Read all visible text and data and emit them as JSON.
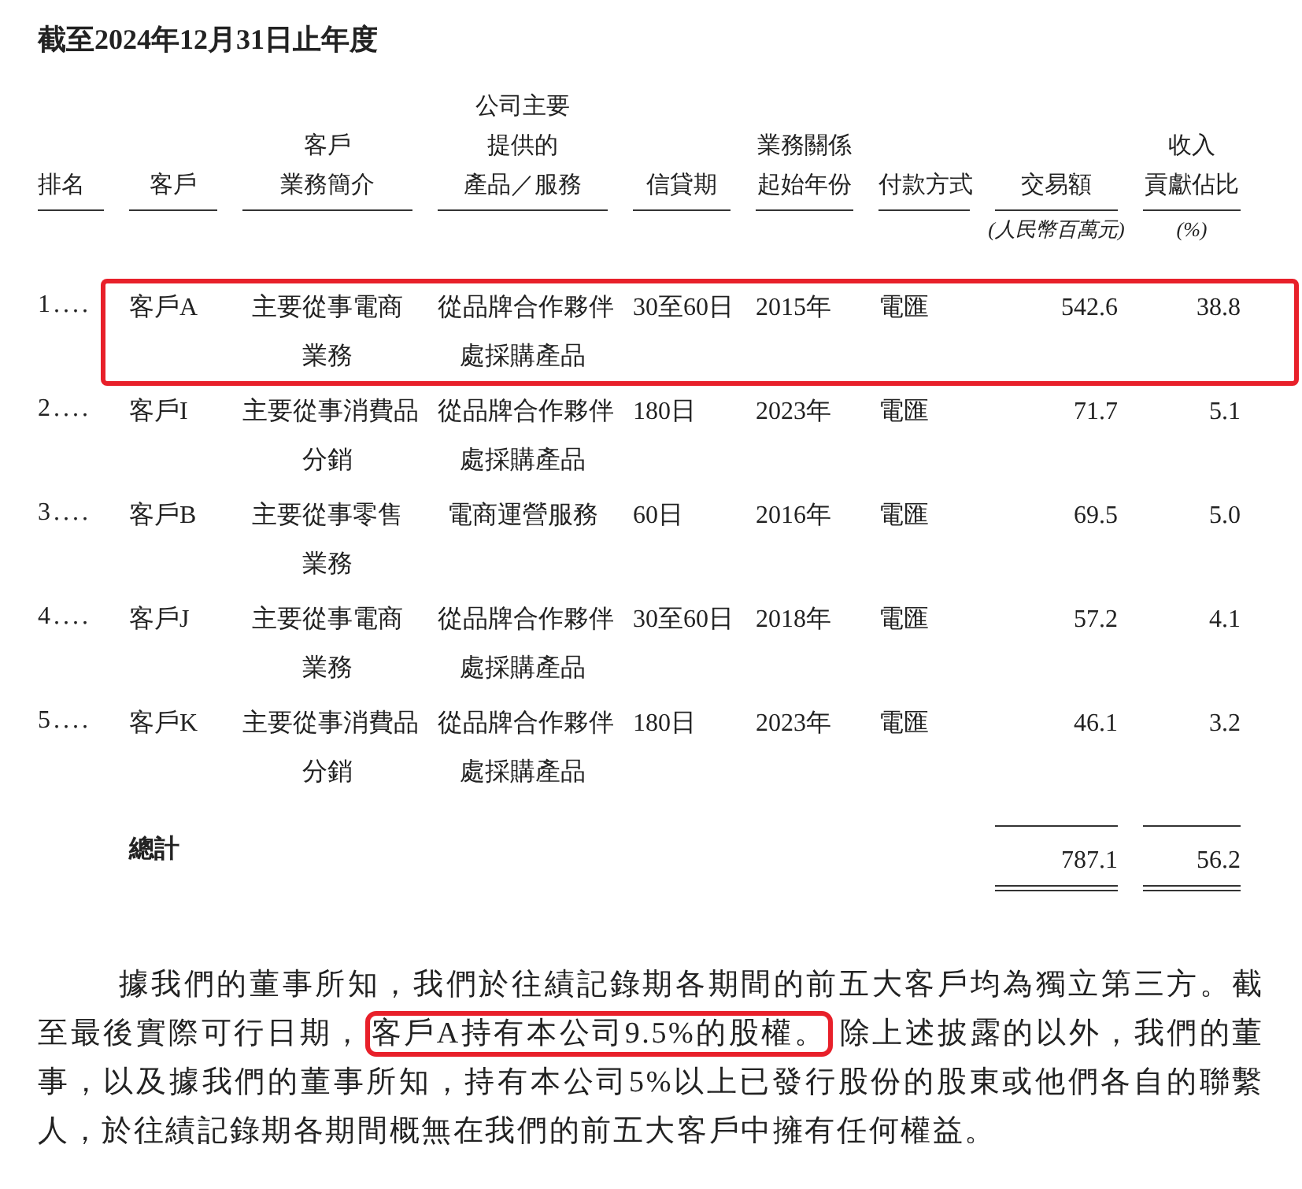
{
  "heading": "截至2024年12月31日止年度",
  "columns": [
    {
      "lines": [
        "排名"
      ]
    },
    {
      "lines": [
        "客戶"
      ]
    },
    {
      "lines": [
        "客戶",
        "業務簡介"
      ]
    },
    {
      "lines": [
        "公司主要",
        "提供的",
        "產品／服務"
      ]
    },
    {
      "lines": [
        "信貸期"
      ]
    },
    {
      "lines": [
        "業務關係",
        "起始年份"
      ]
    },
    {
      "lines": [
        "付款方式"
      ]
    },
    {
      "lines": [
        "交易額"
      ],
      "unit": "(人民幣百萬元)"
    },
    {
      "lines": [
        "收入",
        "貢獻佔比"
      ],
      "unit": "(%)"
    }
  ],
  "rows": [
    {
      "highlighted": true,
      "rank": "1....",
      "customer": "客戶A",
      "business": [
        "主要從事電商",
        "業務"
      ],
      "product": [
        "從品牌合作夥伴",
        "處採購產品"
      ],
      "credit": "30至60日",
      "since": "2015年",
      "payment": "電匯",
      "amount": "542.6",
      "share": "38.8"
    },
    {
      "highlighted": false,
      "rank": "2....",
      "customer": "客戶I",
      "business": [
        "主要從事消費品",
        "分銷"
      ],
      "product": [
        "從品牌合作夥伴",
        "處採購產品"
      ],
      "credit": "180日",
      "since": "2023年",
      "payment": "電匯",
      "amount": "71.7",
      "share": "5.1"
    },
    {
      "highlighted": false,
      "rank": "3....",
      "customer": "客戶B",
      "business": [
        "主要從事零售",
        "業務"
      ],
      "product": [
        "電商運營服務"
      ],
      "credit": "60日",
      "since": "2016年",
      "payment": "電匯",
      "amount": "69.5",
      "share": "5.0"
    },
    {
      "highlighted": false,
      "rank": "4....",
      "customer": "客戶J",
      "business": [
        "主要從事電商",
        "業務"
      ],
      "product": [
        "從品牌合作夥伴",
        "處採購產品"
      ],
      "credit": "30至60日",
      "since": "2018年",
      "payment": "電匯",
      "amount": "57.2",
      "share": "4.1"
    },
    {
      "highlighted": false,
      "rank": "5....",
      "customer": "客戶K",
      "business": [
        "主要從事消費品",
        "分銷"
      ],
      "product": [
        "從品牌合作夥伴",
        "處採購產品"
      ],
      "credit": "180日",
      "since": "2023年",
      "payment": "電匯",
      "amount": "46.1",
      "share": "3.2"
    }
  ],
  "total": {
    "label": "總計",
    "amount": "787.1",
    "share": "56.2"
  },
  "paragraph": [
    {
      "text": "據我們的董事所知，我們於往績記錄期各期間的前五大客戶均為獨立第三方。截至最後實際可行日期，",
      "highlighted": false
    },
    {
      "text": "客戶A持有本公司9.5%的股權。",
      "highlighted": true
    },
    {
      "text": "除上述披露的以外，我們的董事，以及據我們的董事所知，持有本公司5%以上已發行股份的股東或他們各自的聯繫人，於往績記錄期各期間概無在我們的前五大客戶中擁有任何權益。",
      "highlighted": false
    }
  ]
}
